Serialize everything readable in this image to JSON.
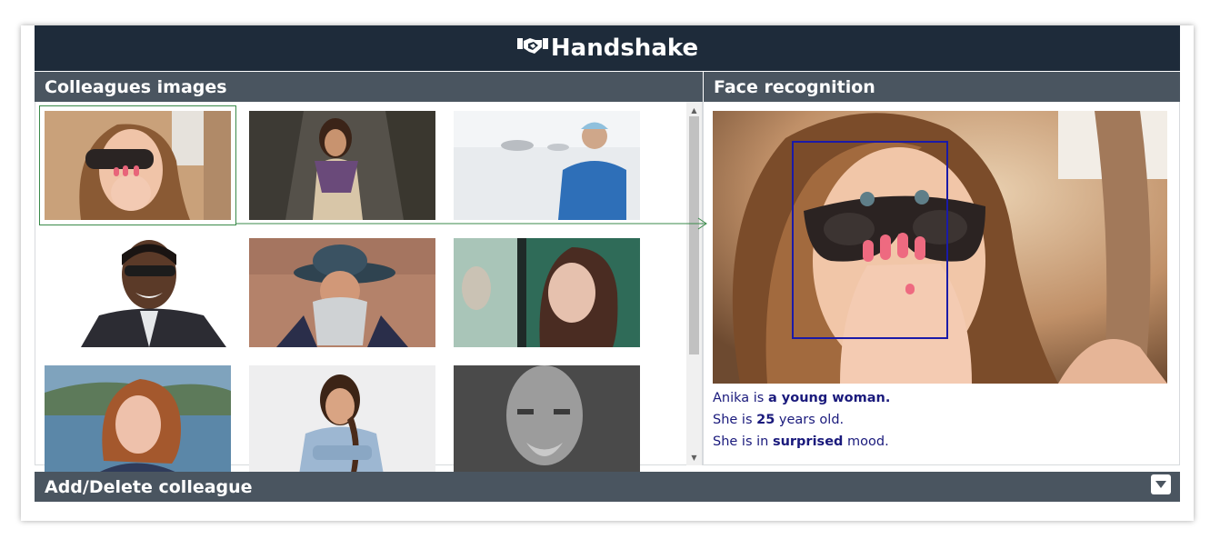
{
  "app": {
    "title": "Handshake",
    "logo_icon": "handshake-icon"
  },
  "left_panel": {
    "title": "Colleagues images",
    "thumbnails": [
      {
        "name": "thumb-woman-sunglasses",
        "selected": true
      },
      {
        "name": "thumb-woman-scarf"
      },
      {
        "name": "thumb-surgeon"
      },
      {
        "name": "thumb-man-sunglasses"
      },
      {
        "name": "thumb-old-man-hat"
      },
      {
        "name": "thumb-woman-window"
      },
      {
        "name": "thumb-redhead-woman"
      },
      {
        "name": "thumb-woman-braid"
      },
      {
        "name": "thumb-bald-man"
      }
    ]
  },
  "right_panel": {
    "title": "Face recognition",
    "line1_prefix": "Anika is ",
    "line1_value": "a young woman.",
    "line2_prefix": "She is ",
    "line2_value": "25",
    "line2_suffix": " years old.",
    "line3_prefix": "She is in ",
    "line3_value": "surprised",
    "line3_suffix": " mood."
  },
  "footer_panel": {
    "title": "Add/Delete colleague",
    "toggle_icon": "chevron-down-icon"
  },
  "colors": {
    "header_bg": "#1e2b3a",
    "panel_title_bg": "#4a5560",
    "description_text": "#1a1a7c",
    "face_box": "#1a1aa8",
    "selection": "#3a8a4a"
  }
}
